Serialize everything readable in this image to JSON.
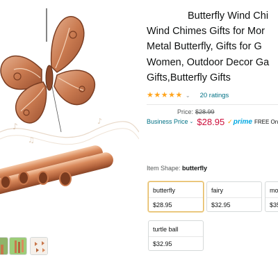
{
  "product": {
    "title_lines": [
      "Butterfly Wind Chi",
      "Wind Chimes Gifts for Mor",
      "Metal Butterfly, Gifts for G",
      "Women, Outdoor Decor Ga",
      "Gifts,Butterfly Gifts"
    ],
    "rating": {
      "stars": 5,
      "chevron": "⌄",
      "ratings_count_text": "20 ratings"
    },
    "pricing": {
      "price_label": "Price:",
      "list_price": "$28.99",
      "business_label": "Business Price",
      "business_chevron": "⌄",
      "business_price": "$28.95",
      "prime_check": "✓",
      "prime_label": "prime",
      "free_text": "FREE One-"
    }
  },
  "variations": {
    "label": "Item Shape:",
    "selected_value": "butterfly",
    "options": [
      {
        "name": "butterfly",
        "price": "$28.95",
        "selected": true
      },
      {
        "name": "fairy",
        "price": "$32.95",
        "selected": false
      },
      {
        "name": "mo",
        "price": "$35",
        "selected": false
      },
      {
        "name": "turtle ball",
        "price": "$32.95",
        "selected": false
      }
    ]
  },
  "colors": {
    "star": "#ffa41c",
    "link": "#007185",
    "price_red": "#cc0c39",
    "prime_blue": "#00a8e1",
    "selected_border": "#e3b860",
    "copper": "#c8764a"
  },
  "icons": {
    "main_image": "copper-butterfly-wind-chime",
    "thumbnails": [
      "green-garden-thumb",
      "chimes-thumb",
      "butterflies-thumb"
    ]
  }
}
